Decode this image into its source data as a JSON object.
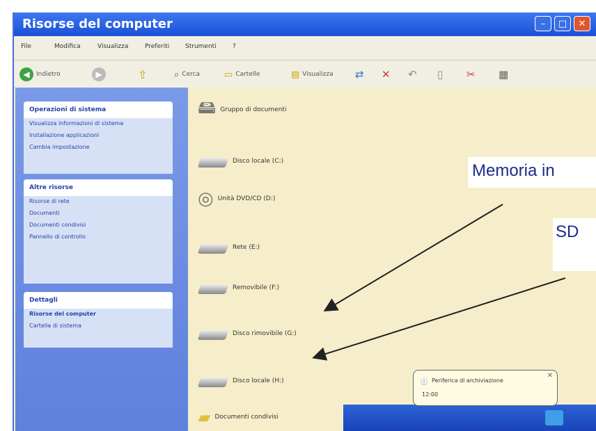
{
  "window": {
    "title": "Risorse del computer"
  },
  "menubar": [
    "File",
    "Modifica",
    "Visualizza",
    "Preferiti",
    "Strumenti",
    "?"
  ],
  "toolbar": {
    "back_label": "Indietro",
    "search_label": "Cerca",
    "folders_label": "Cartelle",
    "views_label": "Visualizza"
  },
  "sidebar": {
    "panels": [
      {
        "title": "Operazioni di sistema",
        "lines": [
          "Visualizza informazioni di sistema",
          "Installazione applicazioni",
          "Cambia impostazione"
        ]
      },
      {
        "title": "Altre risorse",
        "lines": [
          "Risorse di rete",
          "Documenti",
          "Documenti condivisi",
          "Pannello di controllo"
        ]
      },
      {
        "title": "Dettagli",
        "lines": [
          "Risorse del computer",
          "Cartella di sistema"
        ]
      }
    ]
  },
  "drives": [
    {
      "label": "Gruppo di documenti",
      "icon": "drive-icon"
    },
    {
      "label": "Disco locale (C:)",
      "icon": "hard-drive-icon"
    },
    {
      "label": "Unità DVD/CD (D:)",
      "icon": "cd-drive-icon"
    },
    {
      "label": "Rete (E:)",
      "icon": "hard-drive-icon"
    },
    {
      "label": "Removibile (F:)",
      "icon": "hard-drive-icon"
    },
    {
      "label": "Disco rimovibile (G:)",
      "icon": "hard-drive-icon"
    },
    {
      "label": "Disco locale (H:)",
      "icon": "hard-drive-icon"
    },
    {
      "label": "Documenti condivisi",
      "icon": "folder-icon"
    }
  ],
  "annotations": {
    "memoria": "Memoria in",
    "sd": "SD"
  },
  "balloon": {
    "text": "Periferica di archiviazione",
    "sub": "12:00"
  },
  "colors": {
    "titlebar": "#2a64e4",
    "sidebar": "#6c8be2",
    "main_bg": "#f6eeca",
    "annotation": "#1a2d8a"
  }
}
